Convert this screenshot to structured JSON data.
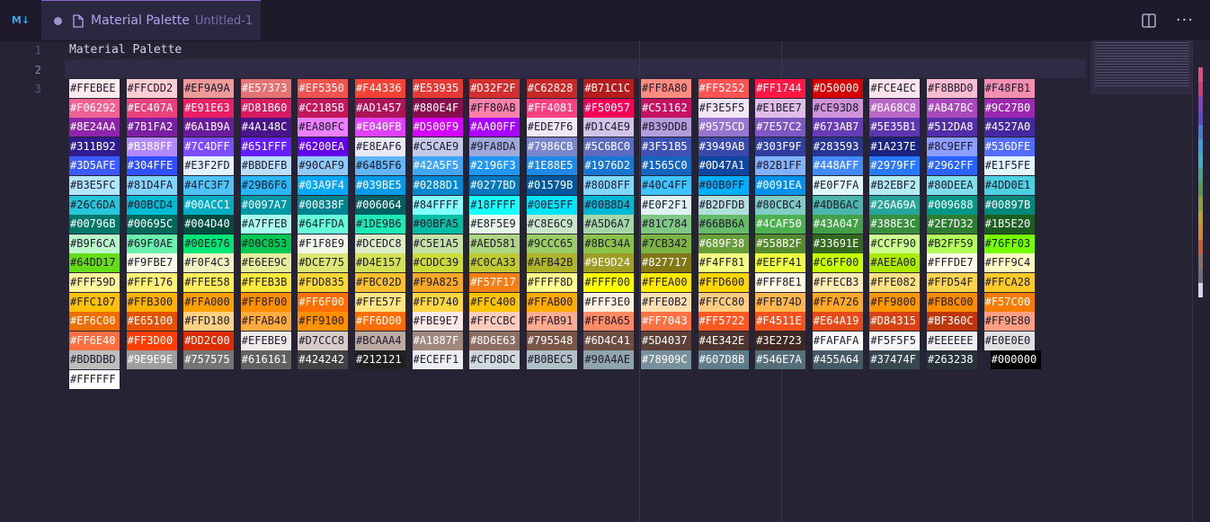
{
  "tab": {
    "lang_badge": "M↓",
    "title": "Material Palette",
    "description": "Untitled-1"
  },
  "actions": {
    "split": "▯▯",
    "more": "···"
  },
  "editor": {
    "line_numbers": [
      "1",
      "2",
      "3"
    ],
    "line1": "Material Palette",
    "colors": [
      "#FFEBEE",
      "#FFCDD2",
      "#EF9A9A",
      "#E57373",
      "#EF5350",
      "#F44336",
      "#E53935",
      "#D32F2F",
      "#C62828",
      "#B71C1C",
      "#FF8A80",
      "#FF5252",
      "#FF1744",
      "#D50000",
      "#FCE4EC",
      "#F8BBD0",
      "#F48FB1",
      "#F06292",
      "#EC407A",
      "#E91E63",
      "#D81B60",
      "#C2185B",
      "#AD1457",
      "#880E4F",
      "#FF80AB",
      "#FF4081",
      "#F50057",
      "#C51162",
      "#F3E5F5",
      "#E1BEE7",
      "#CE93D8",
      "#BA68C8",
      "#AB47BC",
      "#9C27B0",
      "#8E24AA",
      "#7B1FA2",
      "#6A1B9A",
      "#4A148C",
      "#EA80FC",
      "#E040FB",
      "#D500F9",
      "#AA00FF",
      "#EDE7F6",
      "#D1C4E9",
      "#B39DDB",
      "#9575CD",
      "#7E57C2",
      "#673AB7",
      "#5E35B1",
      "#512DA8",
      "#4527A0",
      "#311B92",
      "#B388FF",
      "#7C4DFF",
      "#651FFF",
      "#6200EA",
      "#E8EAF6",
      "#C5CAE9",
      "#9FA8DA",
      "#7986CB",
      "#5C6BC0",
      "#3F51B5",
      "#3949AB",
      "#303F9F",
      "#283593",
      "#1A237E",
      "#8C9EFF",
      "#536DFE",
      "#3D5AFE",
      "#304FFE",
      "#E3F2FD",
      "#BBDEFB",
      "#90CAF9",
      "#64B5F6",
      "#42A5F5",
      "#2196F3",
      "#1E88E5",
      "#1976D2",
      "#1565C0",
      "#0D47A1",
      "#82B1FF",
      "#448AFF",
      "#2979FF",
      "#2962FF",
      "#E1F5FE",
      "#B3E5FC",
      "#81D4FA",
      "#4FC3F7",
      "#29B6F6",
      "#03A9F4",
      "#039BE5",
      "#0288D1",
      "#0277BD",
      "#01579B",
      "#80D8FF",
      "#40C4FF",
      "#00B0FF",
      "#0091EA",
      "#E0F7FA",
      "#B2EBF2",
      "#80DEEA",
      "#4DD0E1",
      "#26C6DA",
      "#00BCD4",
      "#00ACC1",
      "#0097A7",
      "#00838F",
      "#006064",
      "#84FFFF",
      "#18FFFF",
      "#00E5FF",
      "#00B8D4",
      "#E0F2F1",
      "#B2DFDB",
      "#80CBC4",
      "#4DB6AC",
      "#26A69A",
      "#009688",
      "#00897B",
      "#00796B",
      "#00695C",
      "#004D40",
      "#A7FFEB",
      "#64FFDA",
      "#1DE9B6",
      "#00BFA5",
      "#E8F5E9",
      "#C8E6C9",
      "#A5D6A7",
      "#81C784",
      "#66BB6A",
      "#4CAF50",
      "#43A047",
      "#388E3C",
      "#2E7D32",
      "#1B5E20",
      "#B9F6CA",
      "#69F0AE",
      "#00E676",
      "#00C853",
      "#F1F8E9",
      "#DCEDC8",
      "#C5E1A5",
      "#AED581",
      "#9CCC65",
      "#8BC34A",
      "#7CB342",
      "#689F38",
      "#558B2F",
      "#33691E",
      "#CCFF90",
      "#B2FF59",
      "#76FF03",
      "#64DD17",
      "#F9FBE7",
      "#F0F4C3",
      "#E6EE9C",
      "#DCE775",
      "#D4E157",
      "#CDDC39",
      "#C0CA33",
      "#AFB42B",
      "#9E9D24",
      "#827717",
      "#F4FF81",
      "#EEFF41",
      "#C6FF00",
      "#AEEA00",
      "#FFFDE7",
      "#FFF9C4",
      "#FFF59D",
      "#FFF176",
      "#FFEE58",
      "#FFEB3B",
      "#FDD835",
      "#FBC02D",
      "#F9A825",
      "#F57F17",
      "#FFFF8D",
      "#FFFF00",
      "#FFEA00",
      "#FFD600",
      "#FFF8E1",
      "#FFECB3",
      "#FFE082",
      "#FFD54F",
      "#FFCA28",
      "#FFC107",
      "#FFB300",
      "#FFA000",
      "#FF8F00",
      "#FF6F00",
      "#FFE57F",
      "#FFD740",
      "#FFC400",
      "#FFAB00",
      "#FFF3E0",
      "#FFE0B2",
      "#FFCC80",
      "#FFB74D",
      "#FFA726",
      "#FF9800",
      "#FB8C00",
      "#F57C00",
      "#EF6C00",
      "#E65100",
      "#FFD180",
      "#FFAB40",
      "#FF9100",
      "#FF6D00",
      "#FBE9E7",
      "#FFCCBC",
      "#FFAB91",
      "#FF8A65",
      "#FF7043",
      "#FF5722",
      "#F4511E",
      "#E64A19",
      "#D84315",
      "#BF360C",
      "#FF9E80",
      "#FF6E40",
      "#FF3D00",
      "#DD2C00",
      "#EFEBE9",
      "#D7CCC8",
      "#BCAAA4",
      "#A1887F",
      "#8D6E63",
      "#795548",
      "#6D4C41",
      "#5D4037",
      "#4E342E",
      "#3E2723",
      "#FAFAFA",
      "#F5F5F5",
      "#EEEEEE",
      "#E0E0E0",
      "#BDBDBD",
      "#9E9E9E",
      "#757575",
      "#616161",
      "#424242",
      "#212121",
      "#ECEFF1",
      "#CFD8DC",
      "#B0BEC5",
      "#90A4AE",
      "#78909C",
      "#607D8B",
      "#546E7A",
      "#455A64",
      "#37474F",
      "#263238",
      "#000000",
      "#FFFFFF"
    ]
  },
  "ruler_colors": [
    "#e64d7a",
    "#d63c6b",
    "#8a3fc2",
    "#5e45d6",
    "#4a7bd8",
    "#3ea0d8",
    "#3bb3c4",
    "#49a38b",
    "#5a9a4d",
    "#8aa33a",
    "#c2a12d",
    "#d98a2a",
    "#d45a2e",
    "#8a6f63",
    "#6d6d80",
    "#d8d4ea"
  ]
}
